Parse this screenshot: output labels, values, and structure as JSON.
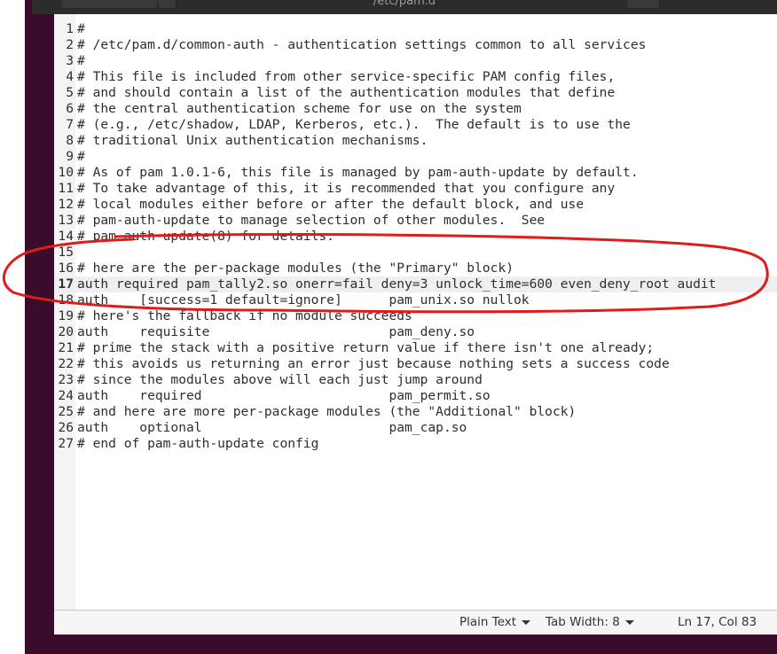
{
  "window": {
    "title": "/etc/pam.d"
  },
  "editor": {
    "current_line": 17,
    "lines": [
      "#",
      "# /etc/pam.d/common-auth - authentication settings common to all services",
      "#",
      "# This file is included from other service-specific PAM config files,",
      "# and should contain a list of the authentication modules that define",
      "# the central authentication scheme for use on the system",
      "# (e.g., /etc/shadow, LDAP, Kerberos, etc.).  The default is to use the",
      "# traditional Unix authentication mechanisms.",
      "#",
      "# As of pam 1.0.1-6, this file is managed by pam-auth-update by default.",
      "# To take advantage of this, it is recommended that you configure any",
      "# local modules either before or after the default block, and use",
      "# pam-auth-update to manage selection of other modules.  See",
      "# pam-auth-update(8) for details.",
      "",
      "# here are the per-package modules (the \"Primary\" block)",
      "auth required pam_tally2.so onerr=fail deny=3 unlock_time=600 even_deny_root audit",
      "auth    [success=1 default=ignore]      pam_unix.so nullok",
      "# here's the fallback if no module succeeds",
      "auth    requisite                       pam_deny.so",
      "# prime the stack with a positive return value if there isn't one already;",
      "# this avoids us returning an error just because nothing sets a success code",
      "# since the modules above will each just jump around",
      "auth    required                        pam_permit.so",
      "# and here are more per-package modules (the \"Additional\" block)",
      "auth    optional                        pam_cap.so",
      "# end of pam-auth-update config"
    ]
  },
  "status": {
    "language": "Plain Text",
    "tab_width": "Tab Width: 8",
    "position": "Ln 17, Col 83"
  },
  "annotation_color": "#e01b1b"
}
